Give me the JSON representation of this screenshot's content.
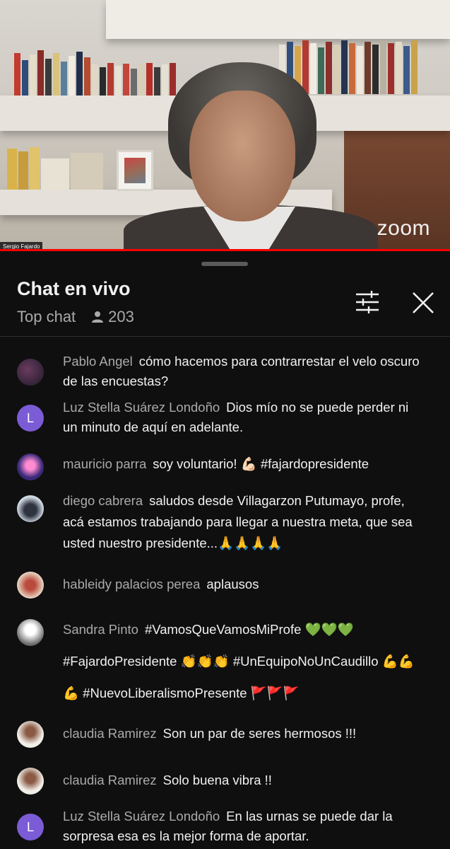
{
  "video": {
    "speaker_name": "Sergio Fajardo",
    "watermark": "zoom",
    "progress_percent": 100
  },
  "chat": {
    "title": "Chat en vivo",
    "mode": "Top chat",
    "viewer_count": "203",
    "messages": [
      {
        "author": "Pablo Angel",
        "text": "cómo hacemos para contrarrestar el velo oscuro de las encuestas?",
        "avatar": "photo"
      },
      {
        "author": "Luz Stella Suárez Londoño",
        "text": "Dios mío no se puede perder ni un minuto de aquí en adelante.",
        "avatar": "L"
      },
      {
        "author": "mauricio parra",
        "text": "soy voluntario! 💪🏻 #fajardopresidente",
        "avatar": "photo"
      },
      {
        "author": "diego cabrera",
        "text": "saludos desde Villagarzon Putumayo, profe, acá estamos trabajando para llegar a nuestra meta, que sea usted nuestro presidente...🙏🙏🙏🙏",
        "avatar": "photo"
      },
      {
        "author": "hableidy palacios perea",
        "text": "aplausos",
        "avatar": "photo"
      },
      {
        "author": "Sandra Pinto",
        "text": "#VamosQueVamosMiProfe 💚💚💚 #FajardoPresidente 👏👏👏 #UnEquipoNoUnCaudillo 💪💪💪 #NuevoLiberalismoPresente 🚩🚩🚩",
        "avatar": "photo"
      },
      {
        "author": "claudia Ramirez",
        "text": "Son un par de seres hermosos !!!",
        "avatar": "photo"
      },
      {
        "author": "claudia Ramirez",
        "text": "Solo buena vibra !!",
        "avatar": "photo"
      },
      {
        "author": "Luz Stella Suárez Londoño",
        "text": "En las urnas se puede dar la sorpresa esa es la mejor forma de aportar.",
        "avatar": "L"
      }
    ]
  },
  "colors": {
    "background": "#0f0f0f",
    "author": "#aaaaaa",
    "text": "#f1f1f1",
    "progress": "#ff0000",
    "letter_avatar": "#7b5cd6"
  }
}
